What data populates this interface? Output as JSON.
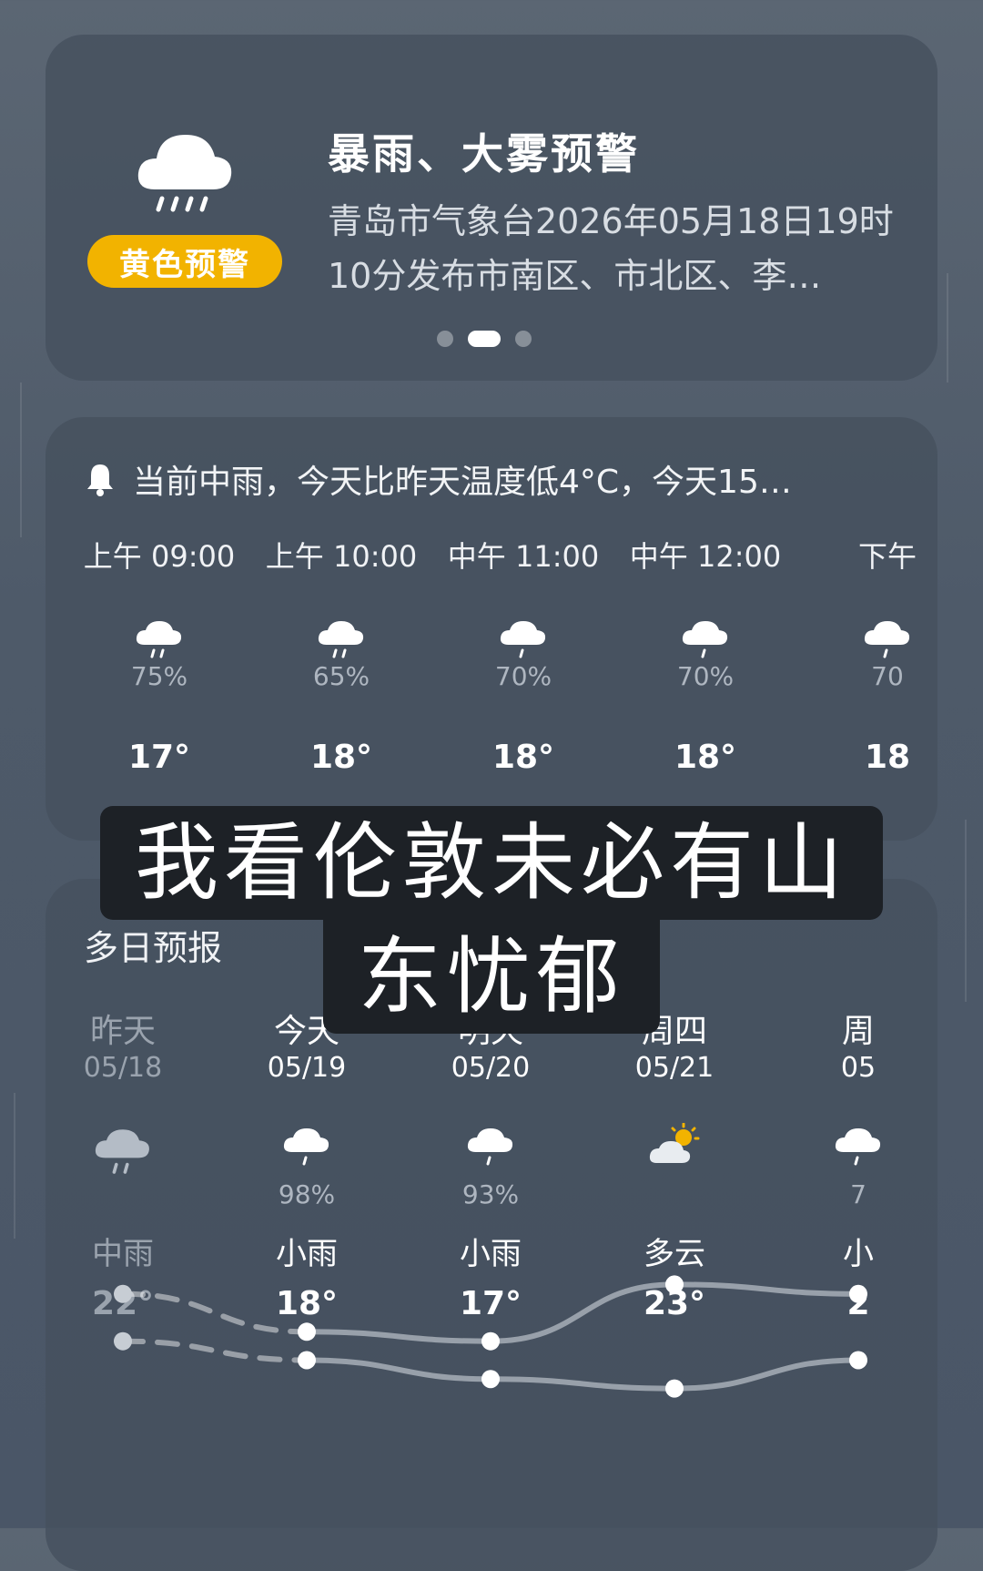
{
  "alert": {
    "badge": "黄色预警",
    "title": "暴雨、大雾预警",
    "description": "青岛市气象台2026年05月18日19时10分发布市南区、市北区、李…",
    "pages": 3,
    "active_page": 1,
    "icon": "rain-cloud-icon",
    "badge_color": "#f2b300"
  },
  "hourly": {
    "summary": "当前中雨，今天比昨天温度低4°C，今天15…",
    "icon": "bell-icon",
    "items": [
      {
        "time": "上午 09:00",
        "icon": "rain-icon",
        "prob": "75%",
        "temp": "17°"
      },
      {
        "time": "上午 10:00",
        "icon": "rain-icon",
        "prob": "65%",
        "temp": "18°"
      },
      {
        "time": "中午 11:00",
        "icon": "light-rain-icon",
        "prob": "70%",
        "temp": "18°"
      },
      {
        "time": "中午 12:00",
        "icon": "light-rain-icon",
        "prob": "70%",
        "temp": "18°"
      },
      {
        "time": "下午",
        "icon": "light-rain-icon",
        "prob": "70",
        "temp": "18"
      }
    ]
  },
  "overlay": {
    "line1": "我看伦敦未必有山",
    "line2": "东忧郁"
  },
  "daily": {
    "title": "多日预报",
    "items": [
      {
        "day": "昨天",
        "date": "05/18",
        "icon": "rain-icon",
        "prob": "",
        "cond": "中雨",
        "temp": "22°",
        "high": 22,
        "low": 17
      },
      {
        "day": "今天",
        "date": "05/19",
        "icon": "light-rain-icon",
        "prob": "98%",
        "cond": "小雨",
        "temp": "18°",
        "high": 18,
        "low": 15
      },
      {
        "day": "明天",
        "date": "05/20",
        "icon": "light-rain-icon",
        "prob": "93%",
        "cond": "小雨",
        "temp": "17°",
        "high": 17,
        "low": 13
      },
      {
        "day": "周四",
        "date": "05/21",
        "icon": "partly-cloudy-icon",
        "prob": "",
        "cond": "多云",
        "temp": "23°",
        "high": 23,
        "low": 12
      },
      {
        "day": "周",
        "date": "05",
        "icon": "light-rain-icon",
        "prob": "7",
        "cond": "小",
        "temp": "2",
        "high": 22,
        "low": 15
      }
    ]
  }
}
